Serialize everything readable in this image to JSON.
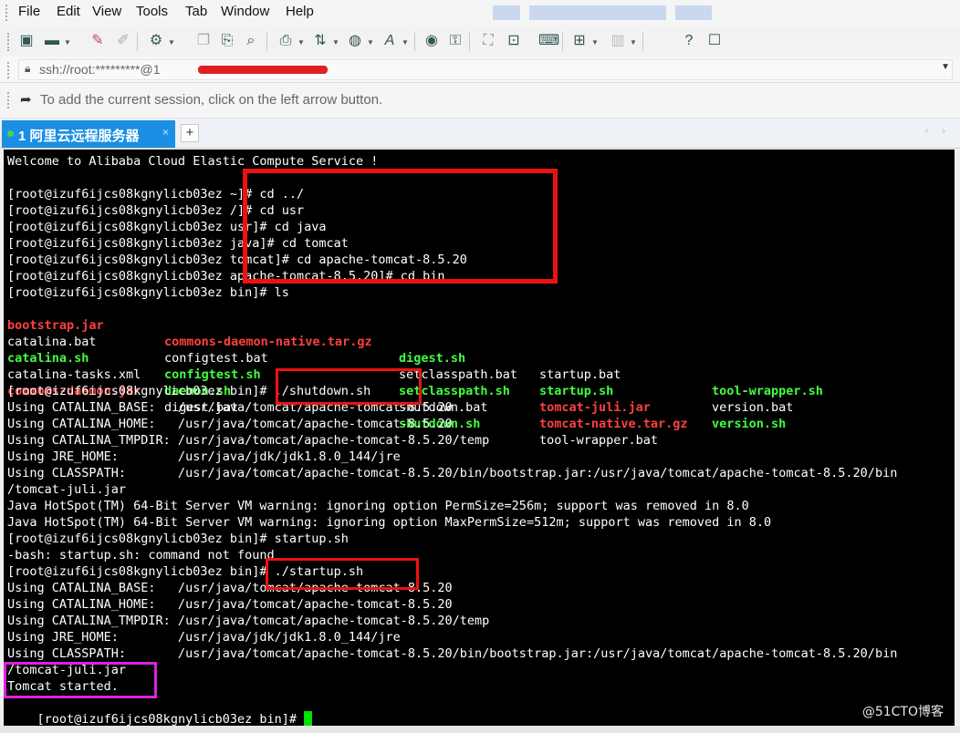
{
  "menu": {
    "file": "File",
    "edit": "Edit",
    "view": "View",
    "tools": "Tools",
    "tab": "Tab",
    "window": "Window",
    "help": "Help"
  },
  "toolbar_icons": [
    "new-session-icon",
    "open-folder-icon",
    "connect-icon",
    "disconnect-icon",
    "properties-icon",
    "copy-icon",
    "paste-icon",
    "find-icon",
    "print-icon",
    "transfer-icon",
    "globe-icon",
    "font-icon",
    "sftp-icon",
    "key-icon",
    "fullscreen-icon",
    "lock-icon",
    "keyboard-icon",
    "compose-icon",
    "layout-icon",
    "help-icon",
    "chat-icon"
  ],
  "address": {
    "text": "ssh://root:*********@1"
  },
  "hint": {
    "text": "To add the current session, click on the left arrow button."
  },
  "tab": {
    "label": "1 阿里云远程服务器",
    "close": "×",
    "add": "+",
    "nav": "‹ ›"
  },
  "terminal": {
    "welcome": "Welcome to Alibaba Cloud Elastic Compute Service !",
    "commands": [
      "[root@izuf6ijcs08kgnylicb03ez ~]# cd ../",
      "[root@izuf6ijcs08kgnylicb03ez /]# cd usr",
      "[root@izuf6ijcs08kgnylicb03ez usr]# cd java",
      "[root@izuf6ijcs08kgnylicb03ez java]# cd tomcat",
      "[root@izuf6ijcs08kgnylicb03ez tomcat]# cd apache-tomcat-8.5.20",
      "[root@izuf6ijcs08kgnylicb03ez apache-tomcat-8.5.20]# cd bin",
      "[root@izuf6ijcs08kgnylicb03ez bin]# ls"
    ],
    "ls_rows": [
      [
        {
          "text": "bootstrap.jar",
          "color": "red"
        },
        {
          "text": "commons-daemon-native.tar.gz",
          "color": "red"
        },
        {
          "text": "digest.sh",
          "color": "green"
        },
        {
          "text": "startup.bat",
          "color": "white"
        },
        {
          "text": "tool-wrapper.sh",
          "color": "green"
        }
      ],
      [
        {
          "text": "catalina.bat",
          "color": "white"
        },
        {
          "text": "configtest.bat",
          "color": "white"
        },
        {
          "text": "setclasspath.bat",
          "color": "white"
        },
        {
          "text": "startup.sh",
          "color": "green"
        },
        {
          "text": "version.bat",
          "color": "white"
        }
      ],
      [
        {
          "text": "catalina.sh",
          "color": "green"
        },
        {
          "text": "configtest.sh",
          "color": "green"
        },
        {
          "text": "setclasspath.sh",
          "color": "green"
        },
        {
          "text": "tomcat-juli.jar",
          "color": "red"
        },
        {
          "text": "version.sh",
          "color": "green"
        }
      ],
      [
        {
          "text": "catalina-tasks.xml",
          "color": "white"
        },
        {
          "text": "daemon.sh",
          "color": "green"
        },
        {
          "text": "shutdown.bat",
          "color": "white"
        },
        {
          "text": "tomcat-native.tar.gz",
          "color": "red"
        },
        {
          "text": "",
          "color": "white"
        }
      ],
      [
        {
          "text": "commons-daemon.jar",
          "color": "red"
        },
        {
          "text": "digest.bat",
          "color": "white"
        },
        {
          "text": "shutdown.sh",
          "color": "green"
        },
        {
          "text": "tool-wrapper.bat",
          "color": "white"
        },
        {
          "text": "",
          "color": "white"
        }
      ]
    ],
    "output": [
      "[root@izuf6ijcs08kgnylicb03ez bin]# ./shutdown.sh",
      "Using CATALINA_BASE:   /usr/java/tomcat/apache-tomcat-8.5.20",
      "Using CATALINA_HOME:   /usr/java/tomcat/apache-tomcat-8.5.20",
      "Using CATALINA_TMPDIR: /usr/java/tomcat/apache-tomcat-8.5.20/temp",
      "Using JRE_HOME:        /usr/java/jdk/jdk1.8.0_144/jre",
      "Using CLASSPATH:       /usr/java/tomcat/apache-tomcat-8.5.20/bin/bootstrap.jar:/usr/java/tomcat/apache-tomcat-8.5.20/bin",
      "/tomcat-juli.jar",
      "Java HotSpot(TM) 64-Bit Server VM warning: ignoring option PermSize=256m; support was removed in 8.0",
      "Java HotSpot(TM) 64-Bit Server VM warning: ignoring option MaxPermSize=512m; support was removed in 8.0",
      "[root@izuf6ijcs08kgnylicb03ez bin]# startup.sh",
      "-bash: startup.sh: command not found",
      "[root@izuf6ijcs08kgnylicb03ez bin]# ./startup.sh",
      "Using CATALINA_BASE:   /usr/java/tomcat/apache-tomcat-8.5.20",
      "Using CATALINA_HOME:   /usr/java/tomcat/apache-tomcat-8.5.20",
      "Using CATALINA_TMPDIR: /usr/java/tomcat/apache-tomcat-8.5.20/temp",
      "Using JRE_HOME:        /usr/java/jdk/jdk1.8.0_144/jre",
      "Using CLASSPATH:       /usr/java/tomcat/apache-tomcat-8.5.20/bin/bootstrap.jar:/usr/java/tomcat/apache-tomcat-8.5.20/bin",
      "/tomcat-juli.jar",
      "Tomcat started."
    ],
    "final_prompt": "[root@izuf6ijcs08kgnylicb03ez bin]# "
  },
  "watermark": "@51CTO博客",
  "colors": {
    "red": "#ff4040",
    "green": "#40ff40",
    "white": "#ffffff",
    "highlight_red": "#ee1111",
    "highlight_magenta": "#e020e0",
    "tab_blue": "#1a8fe3"
  }
}
